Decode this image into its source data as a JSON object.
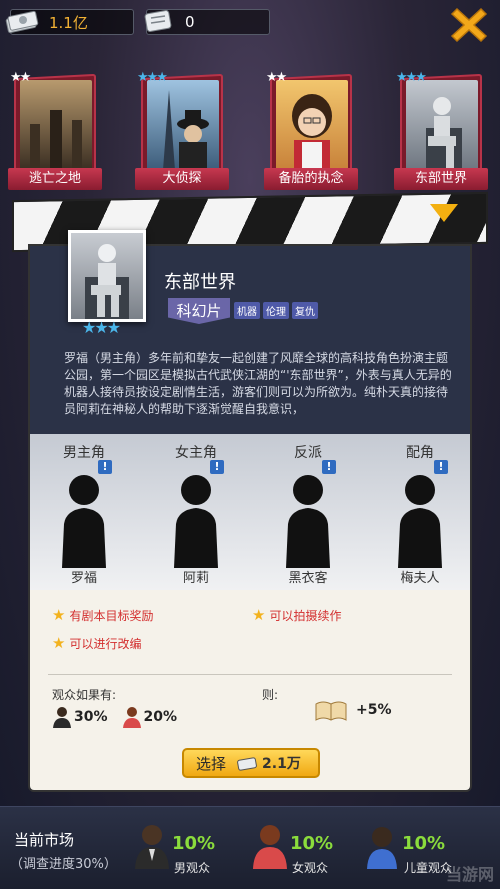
{
  "topbar": {
    "money": "1.1亿",
    "tickets": "0"
  },
  "films": [
    {
      "title": "逃亡之地",
      "stars": "★★",
      "star_color": "#ffffff"
    },
    {
      "title": "大侦探",
      "stars": "★★★",
      "star_color": "#4bb6ea"
    },
    {
      "title": "备胎的执念",
      "stars": "★★",
      "star_color": "#ffffff"
    },
    {
      "title": "东部世界",
      "stars": "★★★",
      "star_color": "#4bb6ea"
    }
  ],
  "detail": {
    "title": "东部世界",
    "genre": "科幻片",
    "tags": [
      "机器",
      "伦理",
      "复仇"
    ],
    "stars": "★★★",
    "description": "罗福（男主角）多年前和挚友一起创建了风靡全球的高科技角色扮演主题公园，第一个园区是模拟古代武侠江湖的“'东部世界”，外表与真人无异的机器人接待员按设定剧情生活，游客们则可以为所欲为。纯朴天真的接待员阿莉在神秘人的帮助下逐渐觉醒自我意识，"
  },
  "roles": [
    {
      "label": "男主角",
      "name": "罗福"
    },
    {
      "label": "女主角",
      "name": "阿莉"
    },
    {
      "label": "反派",
      "name": "黑衣客"
    },
    {
      "label": "配角",
      "name": "梅夫人"
    }
  ],
  "roles_excl": "!",
  "bonuses": {
    "b1": "有剧本目标奖励",
    "b2": "可以拍摄续作",
    "b3": "可以进行改编"
  },
  "audience": {
    "label": "观众如果有:",
    "male_pct": "30%",
    "female_pct": "20%",
    "then_label": "则:",
    "bonus": "+5%"
  },
  "select": {
    "label": "选择",
    "cost": "2.1万"
  },
  "market": {
    "title": "当前市场",
    "progress": "（调查进度30%）",
    "segments": [
      {
        "pct": "10%",
        "label": "男观众"
      },
      {
        "pct": "10%",
        "label": "女观众"
      },
      {
        "pct": "10%",
        "label": "儿童观众"
      }
    ]
  },
  "watermark": "当游网",
  "colors": {
    "accent": "#f3b010",
    "card_red": "#c73850",
    "percent_green": "#8bdc3c"
  }
}
